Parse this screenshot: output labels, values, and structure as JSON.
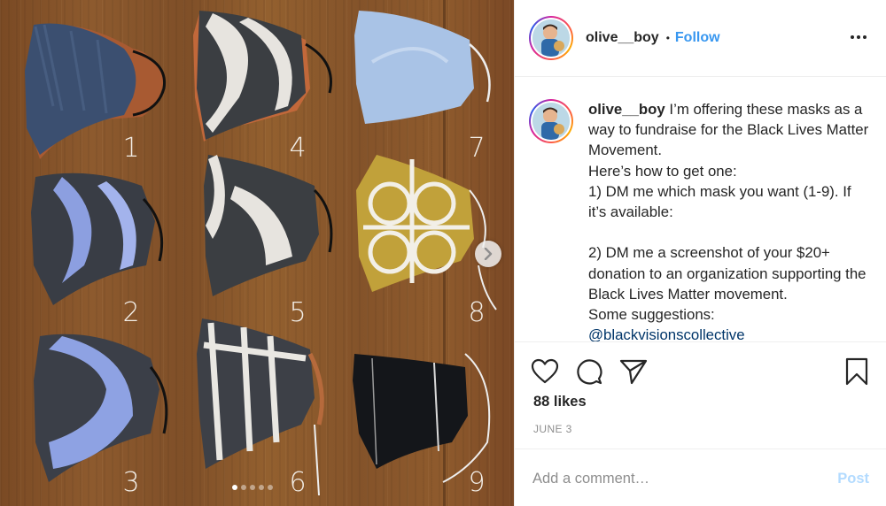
{
  "post": {
    "username": "olive__boy",
    "separator": "•",
    "follow_label": "Follow",
    "more_icon": "more-options-icon"
  },
  "photo": {
    "mask_numbers": [
      "1",
      "2",
      "3",
      "4",
      "5",
      "6",
      "7",
      "8",
      "9"
    ],
    "carousel": {
      "total": 5,
      "active": 1
    },
    "next_icon": "chevron-right-icon"
  },
  "caption": {
    "username": "olive__boy",
    "lines": [
      "I’m offering these masks as a way to fundraise for the Black Lives Matter Movement.",
      "Here’s how to get one:",
      "1) DM me which mask you want (1-9). If it’s available:",
      "",
      "2) DM me a screenshot of your $20+ donation to an organization supporting the Black Lives Matter movement.",
      "Some suggestions:"
    ],
    "mention": "@blackvisionscollective"
  },
  "actions": {
    "icons": [
      "heart-icon",
      "comment-icon",
      "share-icon",
      "bookmark-icon"
    ],
    "likes": "88 likes",
    "date": "JUNE 3"
  },
  "comment": {
    "placeholder": "Add a comment…",
    "post_label": "Post"
  },
  "colors": {
    "link_blue": "#3897f0",
    "post_disabled": "#b3dbff",
    "mention": "#003569",
    "wood": "#8d5a2e"
  }
}
